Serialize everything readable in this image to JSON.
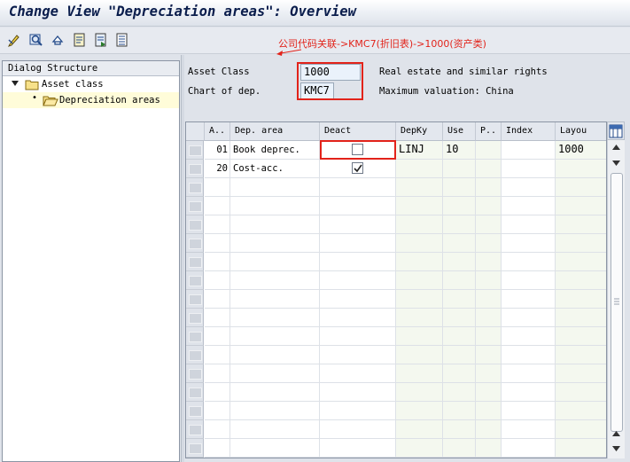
{
  "window": {
    "title": "Change View \"Depreciation areas\": Overview"
  },
  "toolbar": {
    "buttons": [
      {
        "icon": "change-display-icon"
      },
      {
        "icon": "find-icon"
      },
      {
        "icon": "undo-icon"
      },
      {
        "icon": "previous-entry-icon"
      },
      {
        "icon": "next-entry-icon"
      },
      {
        "icon": "list-icon"
      }
    ]
  },
  "annotation": {
    "text": "公司代码关联->KMC7(折旧表)->1000(资产类)",
    "color": "#e2231a"
  },
  "dialog_structure": {
    "header": "Dialog Structure",
    "items": [
      {
        "label": "Asset class",
        "expanded": true
      },
      {
        "label": "Depreciation areas",
        "selected": true
      }
    ]
  },
  "fields": {
    "asset_class_label": "Asset Class",
    "asset_class_value": "1000",
    "asset_class_desc": "Real estate and similar rights",
    "chart_label": "Chart of dep.",
    "chart_value": "KMC7",
    "chart_desc": "Maximum valuation: China"
  },
  "table": {
    "columns": [
      "A..",
      "Dep. area",
      "Deact",
      "DepKy",
      "Use",
      "P..",
      "Index",
      "Layou"
    ],
    "rows": [
      {
        "area": "01",
        "name": "Book deprec.",
        "deact": false,
        "depky": "LINJ",
        "use": "10",
        "p": "",
        "index": "",
        "layout": "1000"
      },
      {
        "area": "20",
        "name": "Cost-acc.",
        "deact": true,
        "depky": "",
        "use": "",
        "p": "",
        "index": "",
        "layout": ""
      }
    ]
  }
}
